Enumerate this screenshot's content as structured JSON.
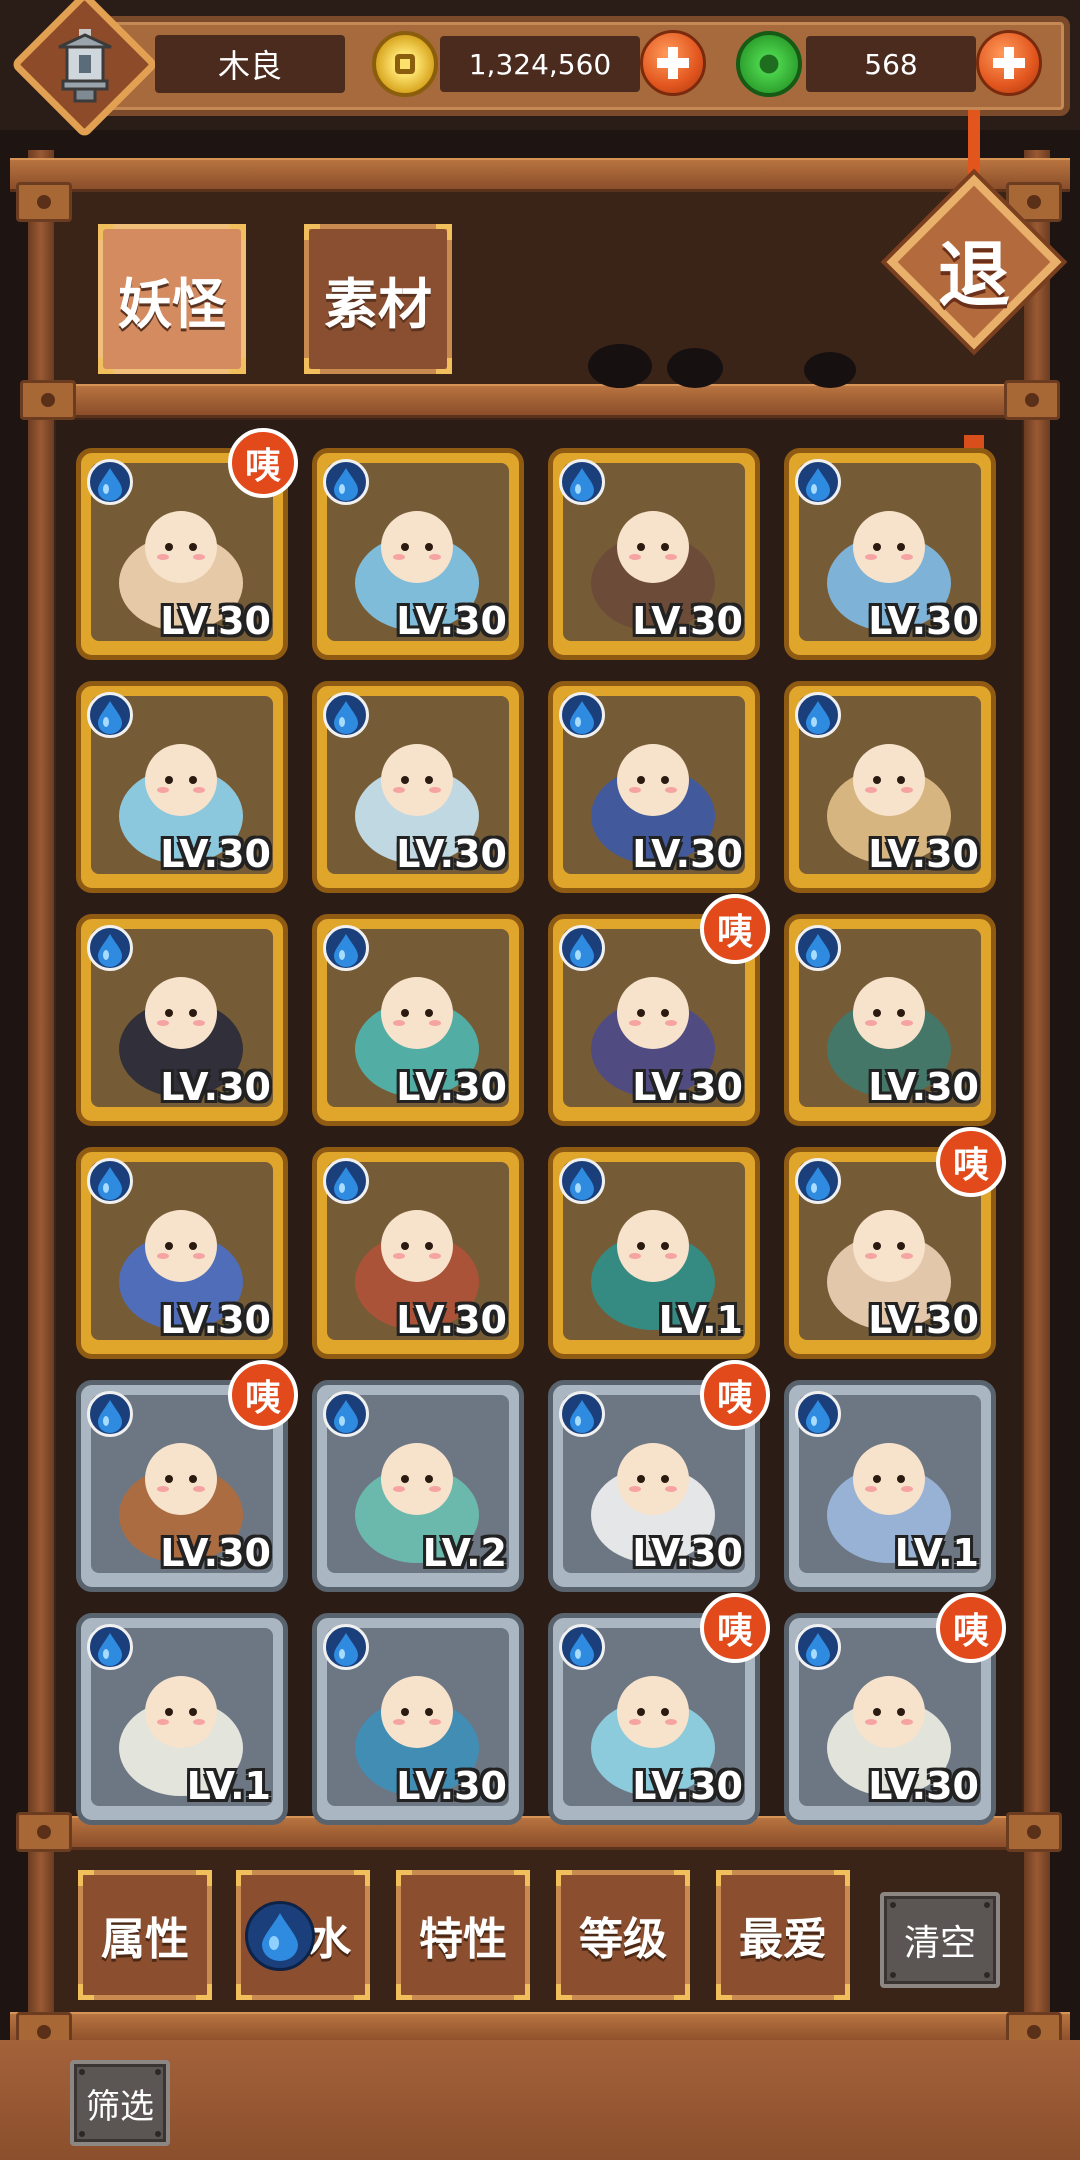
{
  "player": {
    "name": "木良"
  },
  "currency": {
    "coins": "1,324,560",
    "gems": "568"
  },
  "tabs": [
    {
      "label": "妖怪",
      "active": true
    },
    {
      "label": "素材",
      "active": false
    }
  ],
  "exit_label": "退",
  "badge_text": "咦",
  "cards": [
    {
      "level": "LV.30",
      "frame": "gold",
      "badge": true
    },
    {
      "level": "LV.30",
      "frame": "gold",
      "badge": false
    },
    {
      "level": "LV.30",
      "frame": "gold",
      "badge": false
    },
    {
      "level": "LV.30",
      "frame": "gold",
      "badge": false
    },
    {
      "level": "LV.30",
      "frame": "gold",
      "badge": false
    },
    {
      "level": "LV.30",
      "frame": "gold",
      "badge": false
    },
    {
      "level": "LV.30",
      "frame": "gold",
      "badge": false
    },
    {
      "level": "LV.30",
      "frame": "gold",
      "badge": false
    },
    {
      "level": "LV.30",
      "frame": "gold",
      "badge": false
    },
    {
      "level": "LV.30",
      "frame": "gold",
      "badge": false
    },
    {
      "level": "LV.30",
      "frame": "gold",
      "badge": true
    },
    {
      "level": "LV.30",
      "frame": "gold",
      "badge": false
    },
    {
      "level": "LV.30",
      "frame": "gold",
      "badge": false
    },
    {
      "level": "LV.30",
      "frame": "gold",
      "badge": false
    },
    {
      "level": "LV.1",
      "frame": "gold",
      "badge": false
    },
    {
      "level": "LV.30",
      "frame": "gold",
      "badge": true
    },
    {
      "level": "LV.30",
      "frame": "silver",
      "badge": true
    },
    {
      "level": "LV.2",
      "frame": "silver",
      "badge": false
    },
    {
      "level": "LV.30",
      "frame": "silver",
      "badge": true
    },
    {
      "level": "LV.1",
      "frame": "silver",
      "badge": false
    },
    {
      "level": "LV.1",
      "frame": "silver",
      "badge": false
    },
    {
      "level": "LV.30",
      "frame": "silver",
      "badge": false
    },
    {
      "level": "LV.30",
      "frame": "silver",
      "badge": true
    },
    {
      "level": "LV.30",
      "frame": "silver",
      "badge": true
    }
  ],
  "filters": {
    "attribute": "属性",
    "water": "水",
    "trait": "特性",
    "level": "等级",
    "favorite": "最爱",
    "clear": "清空",
    "filter": "筛选"
  },
  "colors": {
    "gold_frame": "#e0a52b",
    "silver_frame": "#aab6c2",
    "badge": "#e24a1c",
    "water_drop": "#2f8be0"
  }
}
